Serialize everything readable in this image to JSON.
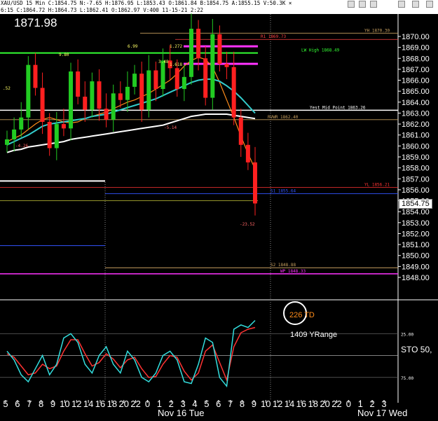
{
  "header": {
    "info_line": "XAU/USD  15 Min  C:1854.75  N:-7.65  H:1876.95  L:1853.43  O:1861.84  B:1854.75  A:1855.15  V:50.3K  ×",
    "sub_line": "6:15  C:1864.72  H:1864.73  L:1862.41  O:1862.97  V:400  11-15-21  2:22"
  },
  "big_label": "1871.98",
  "price_tag": "1854.75",
  "colors": {
    "background": "#000000",
    "up": "#22cc22",
    "down": "#ff2020",
    "ema_fast": "#ff8c1a",
    "ema_mid": "#33cccc",
    "ema_slow": "#ffffff",
    "level": "#ff3333",
    "magenta": "#ff33ff",
    "green_line": "#33ff33",
    "blue_line": "#3355ff",
    "osc_fast": "#33dddd",
    "osc_slow": "#ff3333"
  },
  "chart_data": {
    "type": "line",
    "title": "",
    "xlabel": "",
    "ylabel": "",
    "ylim": [
      1847,
      1872
    ],
    "yticks": [
      "1870.00",
      "1869.00",
      "1868.00",
      "1867.00",
      "1866.00",
      "1865.00",
      "1864.00",
      "1863.00",
      "1862.00",
      "1861.00",
      "1860.00",
      "1859.00",
      "1858.00",
      "1857.00",
      "1856.00",
      "1855.00",
      "1854.00",
      "1853.00",
      "1852.00",
      "1851.00",
      "1850.00",
      "1849.00",
      "1848.00"
    ],
    "xticks": [
      "5",
      "6",
      "7",
      "8",
      "9",
      "10",
      "12",
      "14",
      "16",
      "18",
      "20",
      "22",
      "0",
      "1",
      "2",
      "3",
      "4",
      "5",
      "6",
      "7",
      "8",
      "9",
      "10",
      "12",
      "14",
      "16",
      "18",
      "20",
      "22",
      "0",
      "1",
      "2",
      "3"
    ],
    "date_labels": [
      "Nov 16 Tue",
      "Nov 17 Wed"
    ],
    "close": [
      1860.6,
      1861.5,
      1862.6,
      1867.4,
      1865.3,
      1862.2,
      1859.8,
      1862.0,
      1861.6,
      1866.8,
      1864.5,
      1863.3,
      1865.9,
      1863.4,
      1862.4,
      1864.8,
      1864.2,
      1865.4,
      1866.6,
      1863.3,
      1866.9,
      1865.2,
      1867.8,
      1867.1,
      1865.2,
      1866.3,
      1870.7,
      1868.0,
      1864.4,
      1870.2,
      1867.5,
      1867.2,
      1862.6,
      1860.1,
      1858.5,
      1854.75
    ],
    "series": [
      {
        "name": "ema_fast",
        "values": [
          1860.4,
          1860.7,
          1861.0,
          1861.5,
          1862.0,
          1862.4,
          1862.6,
          1862.4,
          1862.2,
          1862.1,
          1862.2,
          1862.5,
          1862.7,
          1862.9,
          1863.1,
          1863.4,
          1863.7,
          1864.0,
          1864.2,
          1864.5,
          1864.8,
          1865.2,
          1865.6,
          1866.0,
          1866.6,
          1867.3,
          1867.8,
          1868.1,
          1867.9,
          1867.2,
          1865.8,
          1864.2,
          1862.6,
          1860.9,
          1859.3,
          1857.9
        ]
      },
      {
        "name": "ema_mid",
        "values": [
          1860.1,
          1860.4,
          1860.7,
          1861.0,
          1861.4,
          1861.8,
          1862.0,
          1862.1,
          1862.2,
          1862.3,
          1862.4,
          1862.5,
          1862.7,
          1862.8,
          1862.9,
          1863.1,
          1863.3,
          1863.5,
          1863.7,
          1863.9,
          1864.1,
          1864.3,
          1864.6,
          1864.9,
          1865.2,
          1865.5,
          1865.8,
          1866.0,
          1866.1,
          1866.1,
          1865.9,
          1865.5,
          1865.0,
          1864.4,
          1863.7,
          1863.0
        ]
      },
      {
        "name": "ema_slow",
        "values": [
          1859.4,
          1859.6,
          1859.7,
          1859.9,
          1860.0,
          1860.1,
          1860.2,
          1860.3,
          1860.4,
          1860.6,
          1860.7,
          1860.8,
          1860.9,
          1861.0,
          1861.1,
          1861.2,
          1861.3,
          1861.4,
          1861.5,
          1861.6,
          1861.7,
          1861.8,
          1861.9,
          1862.1,
          1862.3,
          1862.5,
          1862.7,
          1862.8,
          1862.9,
          1862.9,
          1862.9,
          1862.9,
          1862.8,
          1862.7,
          1862.6,
          1862.5
        ]
      }
    ],
    "levels": [
      {
        "label": "YH 1870.30",
        "value": 1870.3
      },
      {
        "label": "R1 1869.73",
        "value": 1869.73
      },
      {
        "label": "LW High 1868.49",
        "value": 1868.49
      },
      {
        "label": "Yest Mid Point 1863.26",
        "value": 1863.26
      },
      {
        "label": "RVWR 1862.40",
        "value": 1862.4
      },
      {
        "label": "YL 1856.21",
        "value": 1856.21
      },
      {
        "label": "S1 1855.64",
        "value": 1855.64
      },
      {
        "label": "S2 1848.88",
        "value": 1848.88
      },
      {
        "label": "WP 1848.33",
        "value": 1848.33
      }
    ],
    "annotations": [
      "9.80",
      "6.99",
      "3.48",
      "1.272",
      "1.618",
      "-5.14",
      "-4.26",
      "-23.52",
      ".52"
    ],
    "oscillator": {
      "name": "STO 50,",
      "ylim": [
        0,
        100
      ],
      "ticks": [
        "25.00",
        "75.00"
      ],
      "fast": [
        45,
        55,
        72,
        80,
        65,
        50,
        72,
        60,
        30,
        25,
        35,
        60,
        70,
        50,
        40,
        60,
        70,
        45,
        55,
        75,
        80,
        70,
        50,
        45,
        55,
        80,
        82,
        60,
        30,
        35,
        75,
        85,
        20,
        15,
        18,
        10
      ],
      "slow": [
        48,
        52,
        62,
        72,
        70,
        60,
        65,
        62,
        45,
        32,
        32,
        48,
        62,
        58,
        48,
        54,
        64,
        55,
        52,
        65,
        75,
        74,
        60,
        50,
        52,
        68,
        78,
        70,
        45,
        38,
        58,
        78,
        40,
        24,
        20,
        18
      ]
    },
    "td_label": "226 TD",
    "range_label": "1409 YRange"
  }
}
